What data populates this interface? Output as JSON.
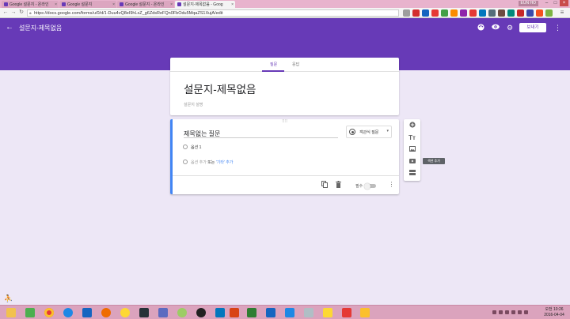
{
  "browser": {
    "tabs": [
      {
        "title": "Google 설문지 - 온라인",
        "active": false
      },
      {
        "title": "Google 설문지",
        "active": false
      },
      {
        "title": "Google 설문지 - 온라인",
        "active": false
      },
      {
        "title": "설문지-제목없음 - Goog",
        "active": true
      }
    ],
    "user_name": "EUN HO",
    "url": "https://docs.google.com/forms/u/0/d/1-Duu4vQ8eI9hLxZ_g6ZdsReFQn0FbOdu5MqaZS1XujA/edit"
  },
  "header": {
    "form_name": "설문지-제목없음",
    "send_label": "보내기",
    "icons": [
      "palette-icon",
      "preview-eye-icon",
      "settings-gear-icon",
      "more-vert-icon"
    ],
    "color": "#673ab7"
  },
  "form_tabs": [
    {
      "label": "질문",
      "active": true
    },
    {
      "label": "응답",
      "active": false
    }
  ],
  "form": {
    "title": "설문지-제목없음",
    "description_placeholder": "설문지 설명"
  },
  "question": {
    "title": "제목없는 질문",
    "type_label": "객관식 질문",
    "option1": "옵션 1",
    "add_option": "옵션 추가",
    "or_label": "또는",
    "add_other": "'기타' 추가",
    "required_label": "필수",
    "required": false
  },
  "side_toolbar": {
    "items": [
      "add-question-icon",
      "add-title-icon",
      "add-image-icon",
      "add-video-icon",
      "add-section-icon"
    ],
    "tooltip": "섹션 추가"
  },
  "taskbar": {
    "time": "오전 10:26",
    "date": "2016-04-04"
  }
}
